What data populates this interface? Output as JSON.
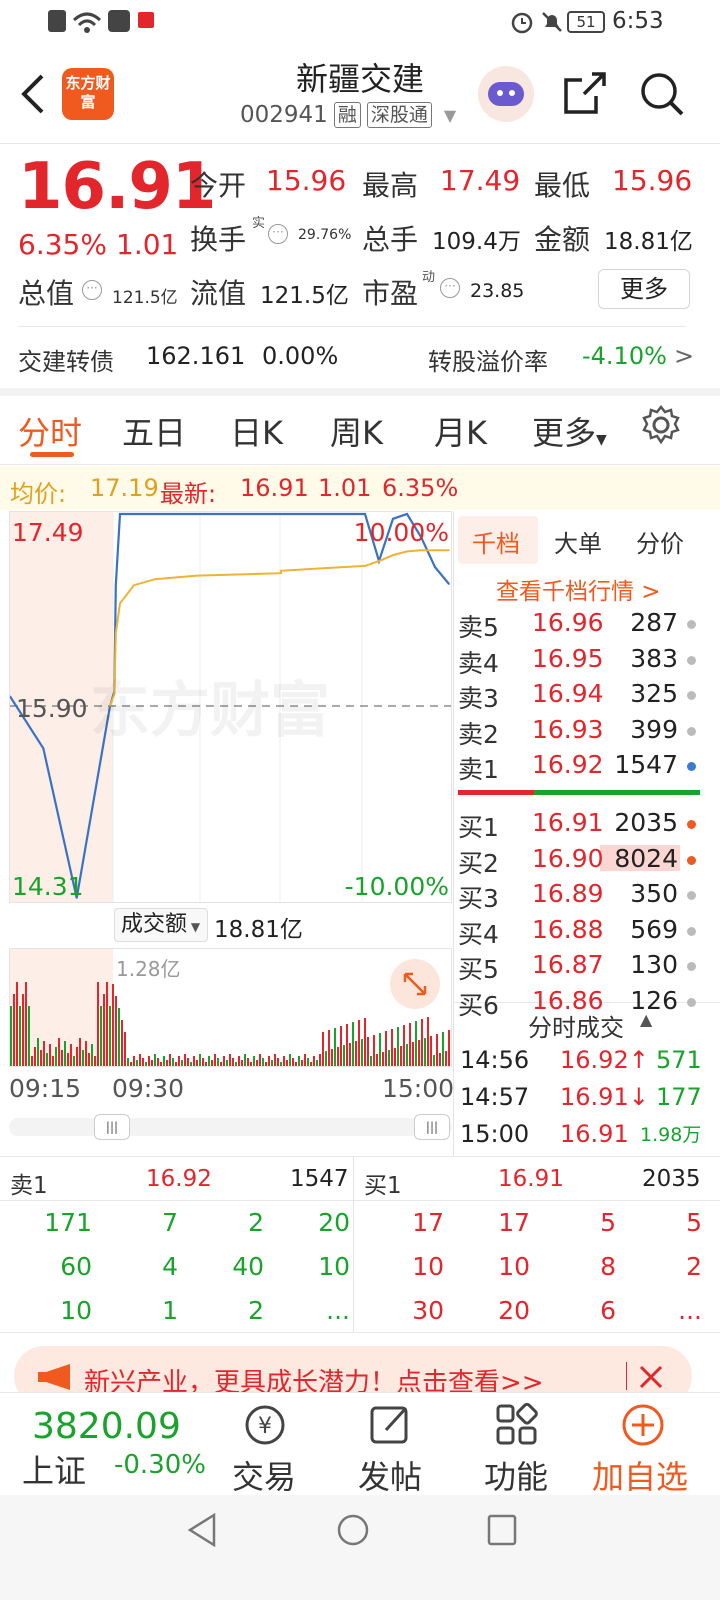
{
  "status": {
    "battery": "51",
    "time": "6:53"
  },
  "header": {
    "logo_text": "东方财富",
    "title": "新疆交建",
    "code": "002941",
    "tag_rong": "融",
    "tag_sgt": "深股通"
  },
  "quote": {
    "price": "16.91",
    "change_pct": "6.35%",
    "change": "1.01",
    "open_label": "今开",
    "open": "15.96",
    "high_label": "最高",
    "high": "17.49",
    "low_label": "最低",
    "low": "15.96",
    "turnover_label": "换手",
    "turnover_sup": "实",
    "turnover": "29.76%",
    "volume_label": "总手",
    "volume": "109.4万",
    "amount_label": "金额",
    "amount": "18.81亿",
    "mktcap_label": "总值",
    "mktcap": "121.5亿",
    "float_label": "流值",
    "float": "121.5亿",
    "pe_label": "市盈",
    "pe_sup": "动",
    "pe": "23.85",
    "more_label": "更多"
  },
  "bond": {
    "name_label": "交建转债",
    "price": "162.161",
    "change": "0.00%",
    "premium_label": "转股溢价率",
    "premium": "-4.10%",
    "arrow": ">"
  },
  "tabs": [
    {
      "label": "分时"
    },
    {
      "label": "五日"
    },
    {
      "label": "日K"
    },
    {
      "label": "周K"
    },
    {
      "label": "月K"
    },
    {
      "label": "更多"
    }
  ],
  "infobar": {
    "avg_label": "均价:",
    "avg": "17.19",
    "latest_label": "最新:",
    "latest": "16.91",
    "chg": "1.01",
    "pct": "6.35%"
  },
  "chart_labels": {
    "top_price": "17.49",
    "mid_price": "15.90",
    "bottom_price": "14.31",
    "top_pct": "10.00%",
    "bottom_pct": "-10.00%",
    "watermark": "东方财富"
  },
  "vol_panel": {
    "selector": "成交额",
    "total": "18.81亿",
    "max": "1.28亿"
  },
  "time_axis": {
    "t1": "09:15",
    "t2": "09:30",
    "t3": "15:00"
  },
  "chart_data": {
    "type": "line",
    "x": [
      "09:15",
      "09:20",
      "09:25",
      "09:30",
      "09:31",
      "09:32",
      "09:35",
      "09:45",
      "10:00",
      "10:30",
      "11:30",
      "13:00",
      "13:30",
      "14:00",
      "14:10",
      "14:20",
      "14:30",
      "14:40",
      "14:50",
      "15:00"
    ],
    "series": [
      {
        "values": [
          15.98,
          15.55,
          14.31,
          15.9,
          16.02,
          16.9,
          17.49,
          17.49,
          17.49,
          17.49,
          17.49,
          17.49,
          17.49,
          17.49,
          17.1,
          17.45,
          17.49,
          17.3,
          17.05,
          16.91
        ]
      },
      {
        "values": [
          null,
          null,
          null,
          15.9,
          16.0,
          16.5,
          16.75,
          16.9,
          16.95,
          16.98,
          17.0,
          17.02,
          17.04,
          17.06,
          17.1,
          17.15,
          17.18,
          17.19,
          17.19,
          17.19
        ]
      }
    ],
    "ylim": [
      14.31,
      17.49
    ]
  },
  "order_book": {
    "tabs": [
      "千档",
      "大单",
      "分价"
    ],
    "view_all": "查看千档行情 >",
    "asks": [
      {
        "label": "卖5",
        "price": "16.96",
        "vol": "287"
      },
      {
        "label": "卖4",
        "price": "16.95",
        "vol": "383"
      },
      {
        "label": "卖3",
        "price": "16.94",
        "vol": "325"
      },
      {
        "label": "卖2",
        "price": "16.93",
        "vol": "399"
      },
      {
        "label": "卖1",
        "price": "16.92",
        "vol": "1547"
      }
    ],
    "bids": [
      {
        "label": "买1",
        "price": "16.91",
        "vol": "2035"
      },
      {
        "label": "买2",
        "price": "16.90",
        "vol": "8024"
      },
      {
        "label": "买3",
        "price": "16.89",
        "vol": "350"
      },
      {
        "label": "买4",
        "price": "16.88",
        "vol": "569"
      },
      {
        "label": "买5",
        "price": "16.87",
        "vol": "130"
      },
      {
        "label": "买6",
        "price": "16.86",
        "vol": "126"
      }
    ]
  },
  "trades": {
    "title": "分时成交",
    "rows": [
      {
        "time": "14:56",
        "price": "16.92",
        "dir": "↑",
        "vol": "571"
      },
      {
        "time": "14:57",
        "price": "16.91",
        "dir": "↓",
        "vol": "177"
      },
      {
        "time": "15:00",
        "price": "16.91",
        "dir": "",
        "vol": "1.98万"
      }
    ]
  },
  "queue": {
    "sell_label": "卖1",
    "sell_price": "16.92",
    "sell_vol": "1547",
    "buy_label": "买1",
    "buy_price": "16.91",
    "buy_vol": "2035",
    "sell_rows": [
      [
        "171",
        "7",
        "2",
        "20"
      ],
      [
        "60",
        "4",
        "40",
        "10"
      ],
      [
        "10",
        "1",
        "2",
        "..."
      ]
    ],
    "buy_rows": [
      [
        "17",
        "17",
        "5",
        "5"
      ],
      [
        "10",
        "10",
        "8",
        "2"
      ],
      [
        "30",
        "20",
        "6",
        "..."
      ]
    ]
  },
  "banner": {
    "text": "新兴产业，更具成长潜力！点击查看>>"
  },
  "bottom": {
    "index_value": "3820.09",
    "index_name": "上证",
    "index_change": "-0.30%",
    "trade": "交易",
    "post": "发帖",
    "func": "功能",
    "add": "加自选"
  }
}
